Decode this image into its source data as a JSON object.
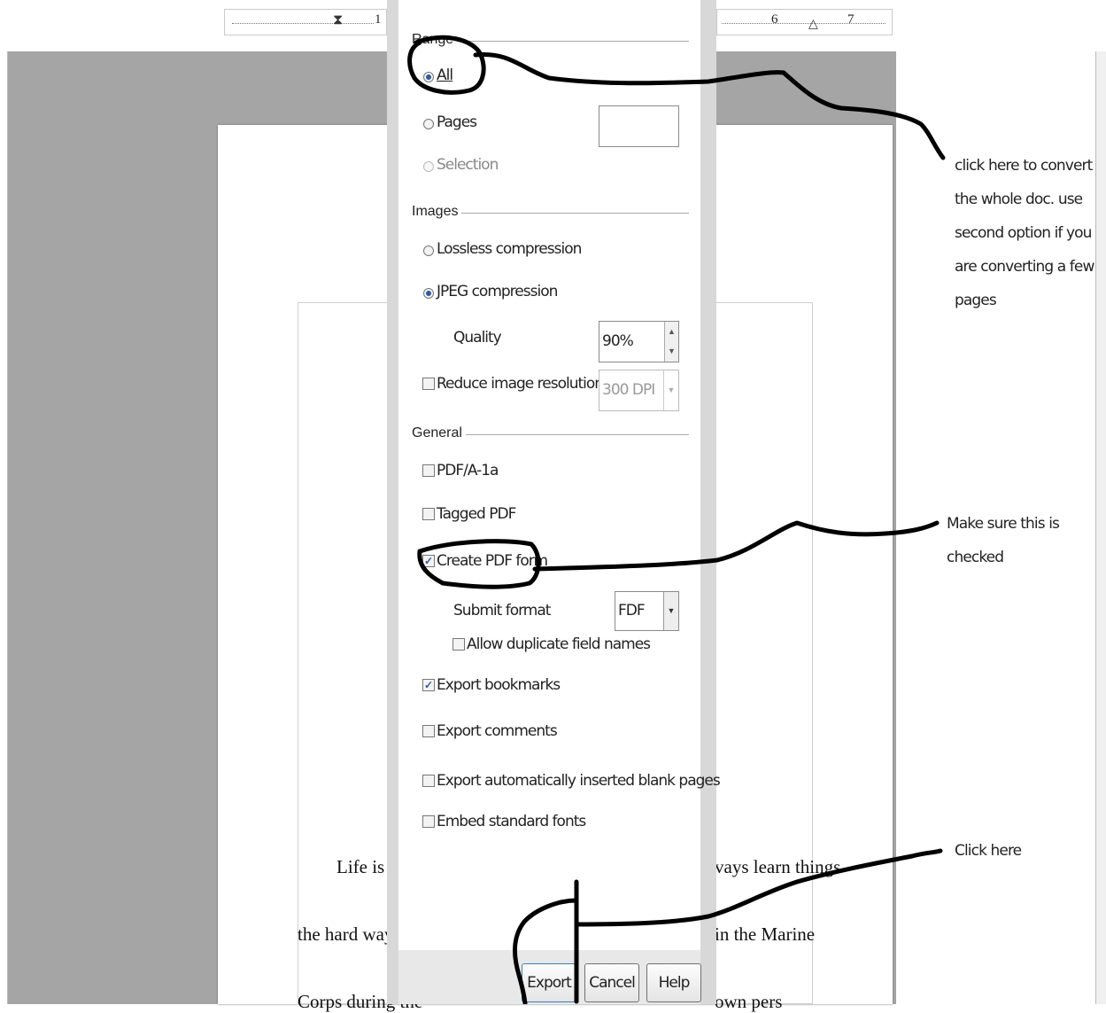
{
  "ruler": {
    "left_number": "1",
    "right_numbers": [
      "6",
      "7"
    ]
  },
  "document": {
    "lines": [
      {
        "left": "Life is a l",
        "right": "vays learn things"
      },
      {
        "left": "the hard way.  Yo",
        "right": "in the Marine"
      },
      {
        "left": "Corps during the",
        "right": "own pers"
      }
    ]
  },
  "dialog": {
    "range": {
      "section_label": "Range",
      "all_label": "All",
      "pages_label": "Pages",
      "pages_value": "",
      "selection_label": "Selection",
      "selected": "All"
    },
    "images": {
      "section_label": "Images",
      "lossless_label": "Lossless compression",
      "jpeg_label": "JPEG compression",
      "selected": "JPEG compression",
      "quality_label": "Quality",
      "quality_value": "90%",
      "reduce_label": "Reduce image resolution",
      "reduce_checked": false,
      "resolution_value": "300 DPI"
    },
    "general": {
      "section_label": "General",
      "pdfa_label": "PDF/A-1a",
      "pdfa_checked": false,
      "tagged_label": "Tagged PDF",
      "tagged_checked": false,
      "form_label": "Create PDF form",
      "form_checked": true,
      "submit_label": "Submit format",
      "submit_value": "FDF",
      "duplicate_label": "Allow duplicate field names",
      "duplicate_checked": false,
      "bookmarks_label": "Export bookmarks",
      "bookmarks_checked": true,
      "comments_label": "Export comments",
      "comments_checked": false,
      "blank_pages_label": "Export automatically inserted blank pages",
      "blank_pages_checked": false,
      "embed_fonts_label": "Embed standard fonts",
      "embed_fonts_checked": false
    },
    "buttons": {
      "export": "Export",
      "cancel": "Cancel",
      "help": "Help"
    }
  },
  "annotations": {
    "range_note": [
      "click here to convert",
      "the whole doc. use",
      "second option if you",
      "are converting a few",
      "pages"
    ],
    "form_note": [
      "Make sure this is",
      "checked"
    ],
    "export_note": [
      "Click here"
    ]
  },
  "colors": {
    "canvas": "#a5a5a5",
    "accent": "#2c5aa0",
    "ink": "#000000"
  }
}
